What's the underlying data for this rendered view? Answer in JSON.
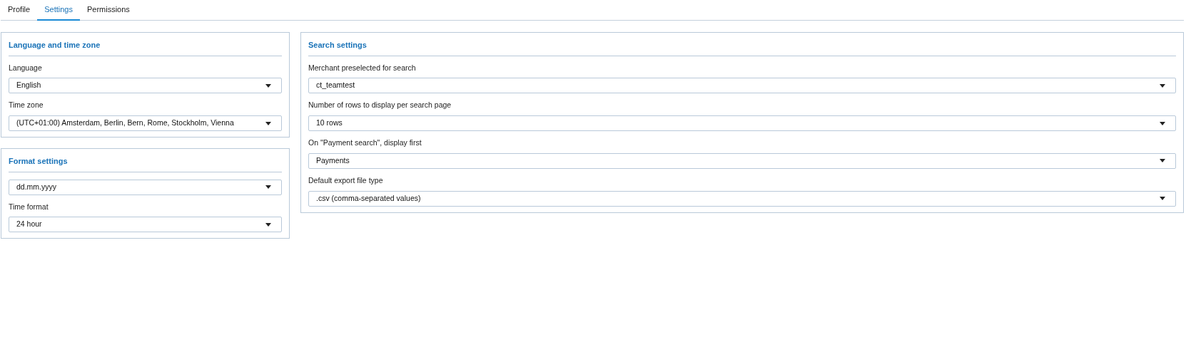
{
  "tabs": [
    {
      "label": "Profile",
      "selected": false
    },
    {
      "label": "Settings",
      "selected": true
    },
    {
      "label": "Permissions",
      "selected": false
    }
  ],
  "left_panels": [
    {
      "title": "Language and time zone",
      "fields": [
        {
          "label": "Language",
          "value": "English"
        },
        {
          "label": "Time zone",
          "value": "(UTC+01:00) Amsterdam, Berlin, Bern, Rome, Stockholm, Vienna"
        }
      ]
    },
    {
      "title": "Format settings",
      "fields": [
        {
          "value": "dd.mm.yyyy"
        },
        {
          "label": "Time format",
          "value": "24 hour"
        }
      ]
    }
  ],
  "right_panels": [
    {
      "title": "Search settings",
      "fields": [
        {
          "label": "Merchant preselected for search",
          "value": "ct_teamtest"
        },
        {
          "label": "Number of rows to display per search page",
          "value": "10 rows"
        },
        {
          "label": "On \"Payment search\", display first",
          "value": "Payments"
        },
        {
          "label": "Default export file type",
          "value": ".csv (comma-separated values)"
        }
      ]
    }
  ]
}
